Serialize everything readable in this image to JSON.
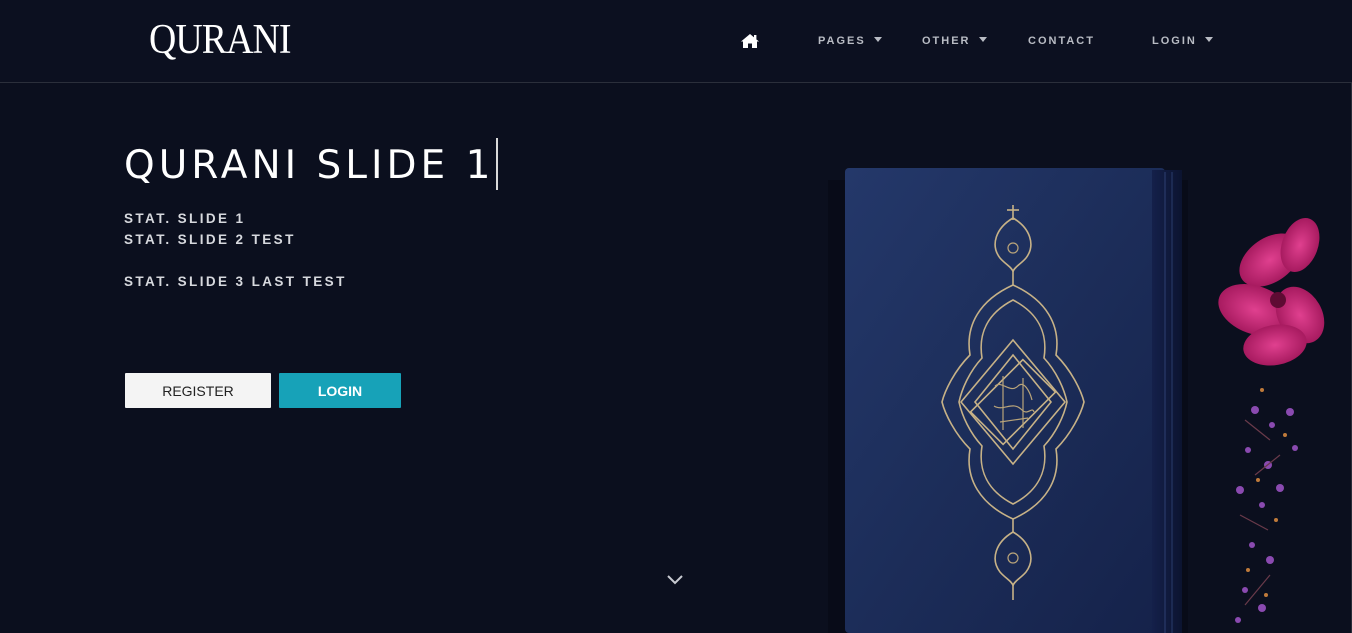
{
  "brand": {
    "logo": "QURANI"
  },
  "nav": {
    "home_icon": "home-icon",
    "items": [
      {
        "label": "PAGES",
        "dropdown": true
      },
      {
        "label": "OTHER",
        "dropdown": true
      },
      {
        "label": "CONTACT",
        "dropdown": false
      },
      {
        "label": "LOGIN",
        "dropdown": true
      }
    ]
  },
  "hero": {
    "title": "QURANI SLIDE 1",
    "stats": [
      "STAT. SLIDE 1",
      "STAT. SLIDE 2 TEST",
      "STAT. SLIDE 3 LAST TEST"
    ],
    "register_label": "REGISTER",
    "login_label": "LOGIN",
    "scroll_icon": "chevron-down-icon",
    "image": "quran-book-photo"
  },
  "colors": {
    "background": "#0b0f1e",
    "accent": "#17a2b8",
    "button_light": "#f4f4f4",
    "book_cover": "#1d2d58",
    "gold": "#c7b287",
    "flower": "#c0216e"
  }
}
